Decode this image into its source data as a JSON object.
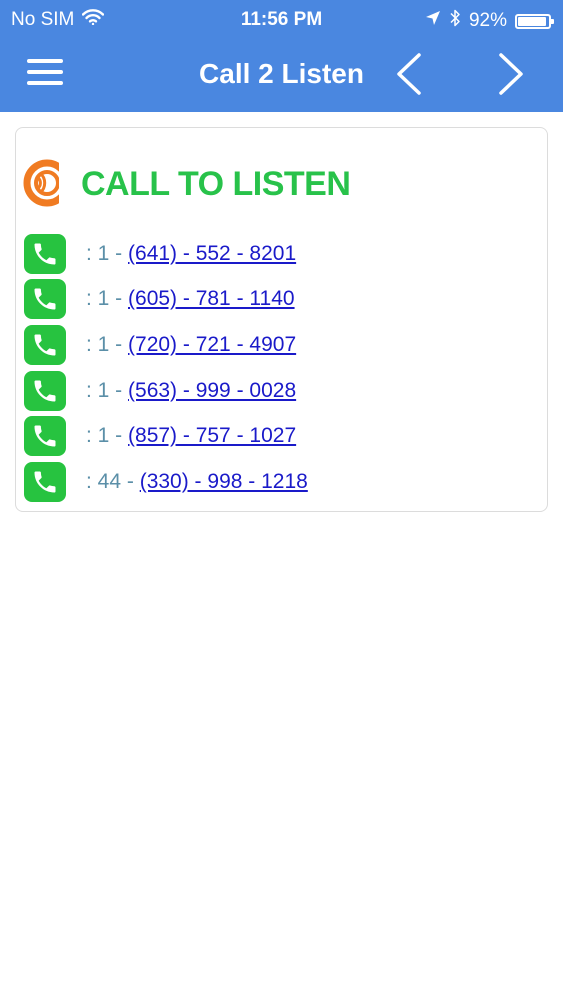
{
  "status_bar": {
    "carrier": "No SIM",
    "time": "11:56 PM",
    "battery": "92%",
    "battery_level": 0.92
  },
  "nav": {
    "title": "Call 2 Listen",
    "menu_icon": "hamburger-menu-icon",
    "prev_icon": "chevron-left-icon",
    "next_icon": "chevron-right-icon"
  },
  "logo": {
    "text": "CALL TO LISTEN",
    "colors": {
      "text": "#28c24a",
      "emblem": "#f07b22"
    }
  },
  "phones": [
    {
      "prefix": ": 1 - ",
      "number": "(641) - 552 - 8201"
    },
    {
      "prefix": ": 1 - ",
      "number": "(605) - 781 - 1140"
    },
    {
      "prefix": ": 1 - ",
      "number": "(720) - 721 - 4907"
    },
    {
      "prefix": ": 1 - ",
      "number": "(563) - 999 - 0028"
    },
    {
      "prefix": ": 1 - ",
      "number": "(857) - 757 - 1027"
    },
    {
      "prefix": ": 44 - ",
      "number": "(330) - 998 - 1218"
    }
  ],
  "colors": {
    "header": "#4a87e0",
    "phone_icon_bg": "#27c340",
    "link": "#1a1ac9",
    "prefix": "#5b8fa8"
  }
}
